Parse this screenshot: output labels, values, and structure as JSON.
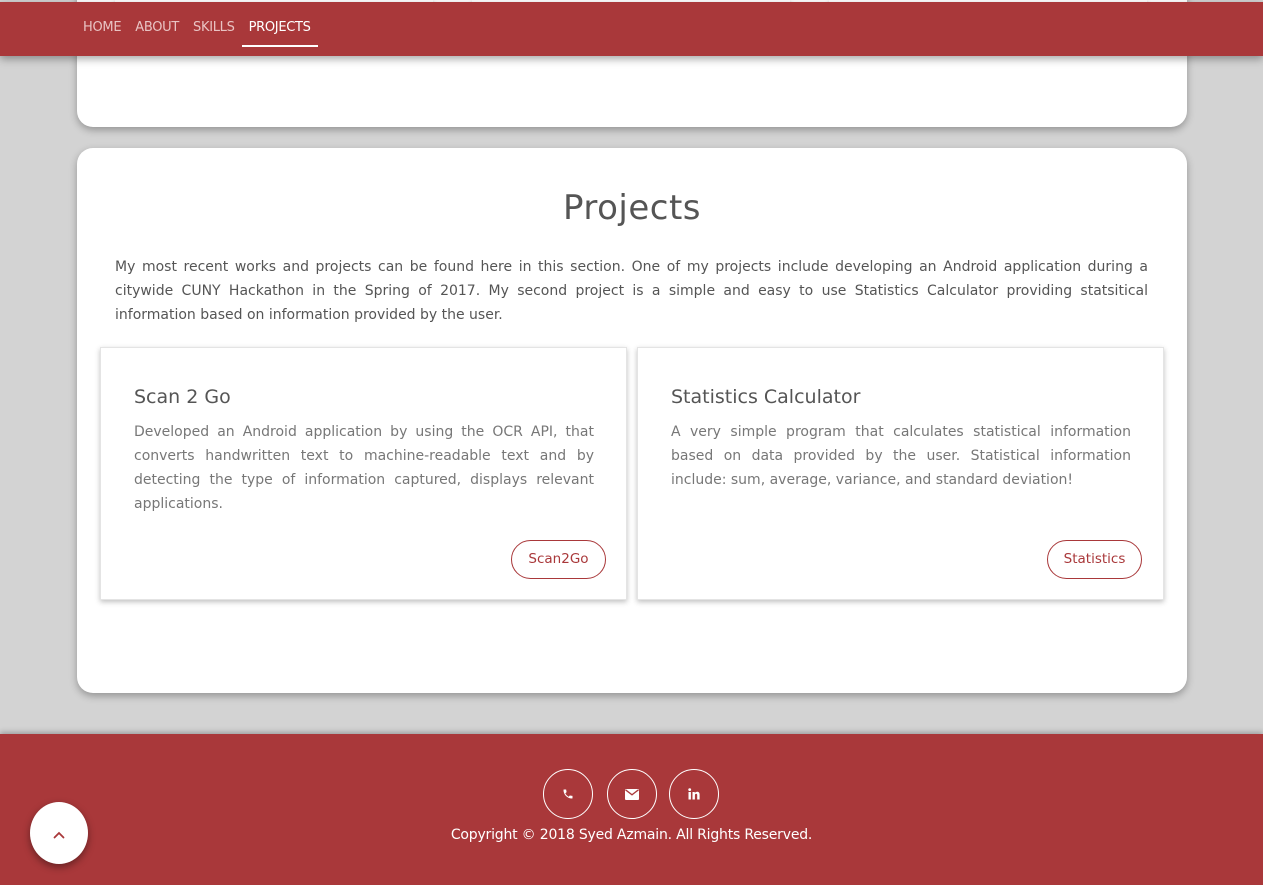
{
  "nav": {
    "items": [
      "HOME",
      "ABOUT",
      "SKILLS",
      "PROJECTS"
    ],
    "active": "PROJECTS"
  },
  "projects": {
    "title": "Projects",
    "description": "My most recent works and projects can be found here in this section. One of my projects include developing an Android application during a citywide CUNY Hackathon in the Spring of 2017. My second project is a simple and easy to use Statistics Calculator providing statsitical information based on information provided by the user.",
    "cards": [
      {
        "title": "Scan 2 Go",
        "description": "Developed an Android application by using the OCR API, that converts handwritten text to machine-readable text and by detecting the type of information captured, displays relevant applications.",
        "button": "Scan2Go"
      },
      {
        "title": "Statistics Calculator",
        "description": "A very simple program that calculates statistical information based on data provided by the user. Statistical information include: sum, average, variance, and standard deviation!",
        "button": "Statistics"
      }
    ]
  },
  "footer": {
    "social_icons": [
      "phone-icon",
      "envelope-icon",
      "linkedin-icon"
    ],
    "copyright": "Copyright © 2018 Syed Azmain. All Rights Reserved."
  },
  "back_to_top_icon": "chevron-up-icon",
  "colors": {
    "brand": "#a9383a",
    "background": "#d3d3d3",
    "card": "#ffffff",
    "text": "#555555"
  }
}
